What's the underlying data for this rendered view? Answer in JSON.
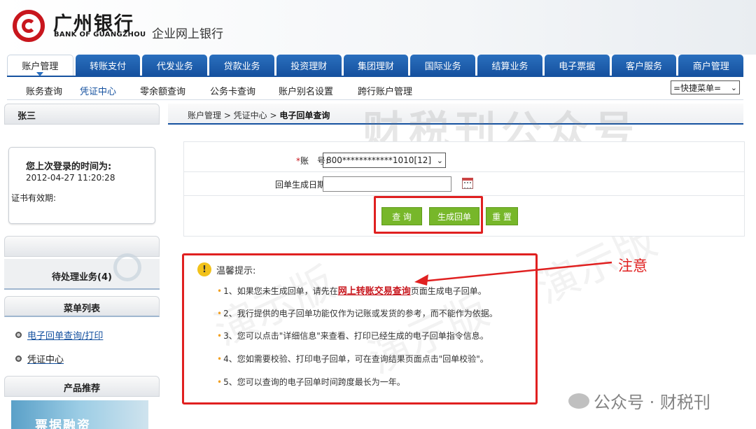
{
  "header": {
    "bank_cn": "广州银行",
    "bank_en": "BANK OF GUANGZHOU",
    "subtitle": "企业网上银行"
  },
  "mainnav": [
    {
      "label": "账户管理",
      "active": true
    },
    {
      "label": "转账支付"
    },
    {
      "label": "代发业务"
    },
    {
      "label": "贷款业务"
    },
    {
      "label": "投资理财"
    },
    {
      "label": "集团理财"
    },
    {
      "label": "国际业务"
    },
    {
      "label": "结算业务"
    },
    {
      "label": "电子票据"
    },
    {
      "label": "客户服务"
    },
    {
      "label": "商户管理"
    }
  ],
  "subnav": [
    {
      "label": "账务查询"
    },
    {
      "label": "凭证中心",
      "active": true
    },
    {
      "label": "零余额查询"
    },
    {
      "label": "公务卡查询"
    },
    {
      "label": "账户别名设置"
    },
    {
      "label": "跨行账户管理"
    }
  ],
  "quick_menu": "=快捷菜单=",
  "sidebar": {
    "user_name": "张三",
    "last_login_label": "您上次登录的时间为:",
    "last_login_time": "2012-04-27 11:20:28",
    "cert_label": "证书有效期:",
    "pending": "待处理业务(4)",
    "menu_title": "菜单列表",
    "menu_items": [
      "电子回单查询/打印",
      "凭证中心"
    ],
    "product_title": "产品推荐",
    "banner_text": "票据融资"
  },
  "breadcrumb": {
    "path": "账户管理 > 凭证中心 > ",
    "current": "电子回单查询"
  },
  "watermark_top": "财税刊公众号",
  "form": {
    "account_label": "账　号:",
    "account_required": "*",
    "account_value": "800************1010[12]",
    "date_label": "回单生成日期:",
    "date_value": "",
    "btn_query": "查 询",
    "btn_generate": "生成回单",
    "btn_reset": "重 置"
  },
  "tips": {
    "title": "温馨提示:",
    "items": [
      {
        "before": "1、如果您未生成回单，请先在",
        "link": "网上转账交易查询",
        "after": "页面生成电子回单。"
      },
      {
        "before": "2、我行提供的电子回单功能仅作为记账或发货的参考，而不能作为依据。"
      },
      {
        "before": "3、您可以点击\"详细信息\"来查看、打印已经生成的电子回单指令信息。"
      },
      {
        "before": "4、您如需要校验、打印电子回单，可在查询结果页面点击\"回单校验\"。"
      },
      {
        "before": "5、您可以查询的电子回单时间跨度最长为一年。"
      }
    ]
  },
  "annotation": "注意",
  "wechat_watermark": "公众号 · 财税刊",
  "bg_watermark": "演示版",
  "colors": {
    "brand_red": "#c8161d",
    "nav_blue": "#1652a0",
    "button_green": "#77b72a",
    "annotation_red": "#e02020"
  }
}
